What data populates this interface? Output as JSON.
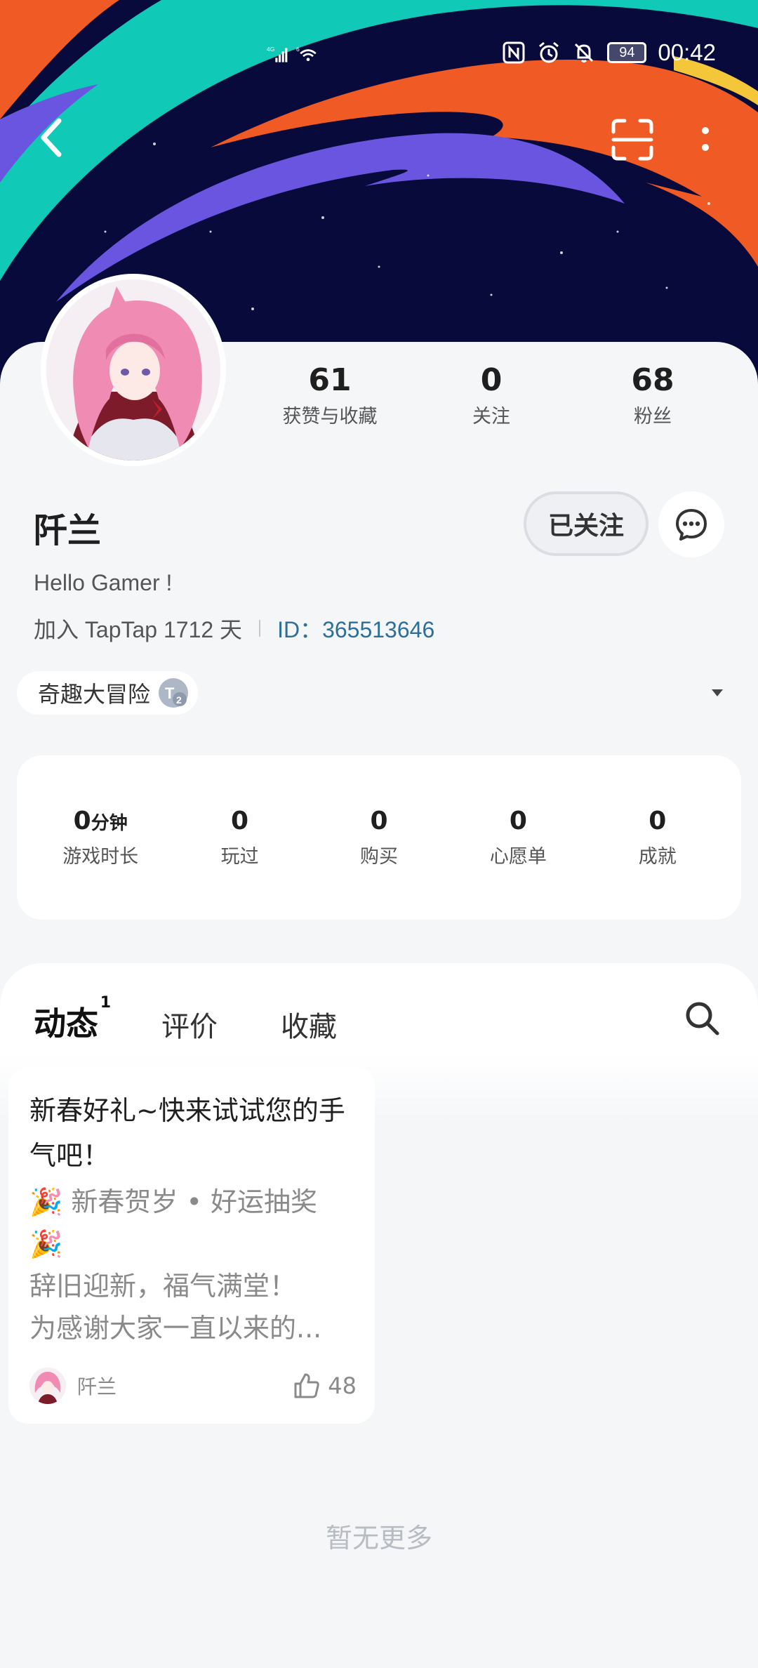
{
  "status_bar": {
    "network_left": "4G",
    "network_right": "6",
    "battery": "94",
    "time": "00:42"
  },
  "profile": {
    "stats": [
      {
        "value": "61",
        "label": "获赞与收藏"
      },
      {
        "value": "0",
        "label": "关注"
      },
      {
        "value": "68",
        "label": "粉丝"
      }
    ],
    "name": "阡兰",
    "follow_label": "已关注",
    "bio": "Hello Gamer !",
    "join_text": "加入 TapTap 1712 天",
    "id_text": "ID：365513646",
    "badge_label": "奇趣大冒险"
  },
  "game_stats": [
    {
      "value": "0",
      "unit": "分钟",
      "label": "游戏时长"
    },
    {
      "value": "0",
      "unit": "",
      "label": "玩过"
    },
    {
      "value": "0",
      "unit": "",
      "label": "购买"
    },
    {
      "value": "0",
      "unit": "",
      "label": "心愿单"
    },
    {
      "value": "0",
      "unit": "",
      "label": "成就"
    }
  ],
  "tabs": [
    {
      "label": "动态",
      "count": "1",
      "active": true
    },
    {
      "label": "评价",
      "active": false
    },
    {
      "label": "收藏",
      "active": false
    }
  ],
  "post": {
    "title": "新春好礼~快来试试您的手气吧！",
    "line1_text": "新春贺岁 • 好运抽奖",
    "line3": "辞旧迎新，福气满堂！",
    "line4": "为感谢大家一直以来的...",
    "author": "阡兰",
    "likes": "48"
  },
  "footer_text": "暂无更多",
  "colors": {
    "accent": "#14c8c0",
    "id_link": "#2b6f9a",
    "banner_bg": "#070a3a",
    "stripe_teal": "#10c9b6",
    "stripe_orange": "#f05a24",
    "stripe_purple": "#6a55e0"
  }
}
